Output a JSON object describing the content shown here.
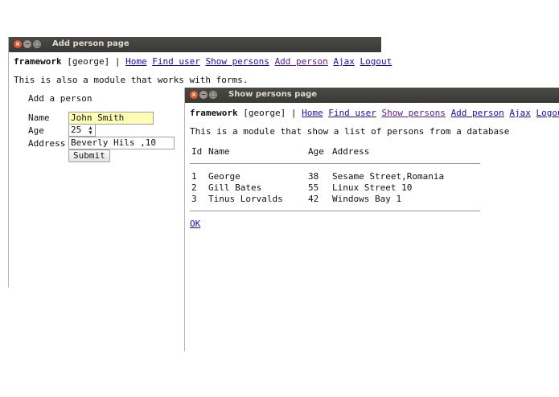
{
  "window1": {
    "title": "Add person page",
    "nav": {
      "brand": "framework",
      "user": "[george]",
      "separator": "|",
      "links": [
        "Home",
        "Find user",
        "Show persons",
        "Add person",
        "Ajax",
        "Logout"
      ]
    },
    "intro": "This is also a module that works with forms.",
    "form": {
      "heading": "Add a person",
      "name_label": "Name",
      "name_value": "John Smith",
      "age_label": "Age",
      "age_value": "25",
      "address_label": "Address",
      "address_value": "Beverly Hils ,10",
      "submit_label": "Submit"
    }
  },
  "window2": {
    "title": "Show persons page",
    "nav": {
      "brand": "framework",
      "user": "[george]",
      "separator": "|",
      "links": [
        "Home",
        "Find user",
        "Show persons",
        "Add person",
        "Ajax",
        "Logout"
      ]
    },
    "intro": "This is a module that show a list of persons from a database",
    "table": {
      "headers": [
        "Id",
        "Name",
        "Age",
        "Address"
      ],
      "rows": [
        [
          "1",
          "George",
          "38",
          "Sesame Street,Romania"
        ],
        [
          "2",
          "Gill Bates",
          "55",
          "Linux Street 10"
        ],
        [
          "3",
          "Tinus Lorvalds",
          "42",
          "Windows Bay 1"
        ]
      ]
    },
    "ok_link": "OK"
  },
  "colors": {
    "titlebar": "#3a3935",
    "close_button": "#e4562a",
    "link": "#1a0dab",
    "visited_link": "#551a8b",
    "highlight_field": "#fefdb6"
  }
}
